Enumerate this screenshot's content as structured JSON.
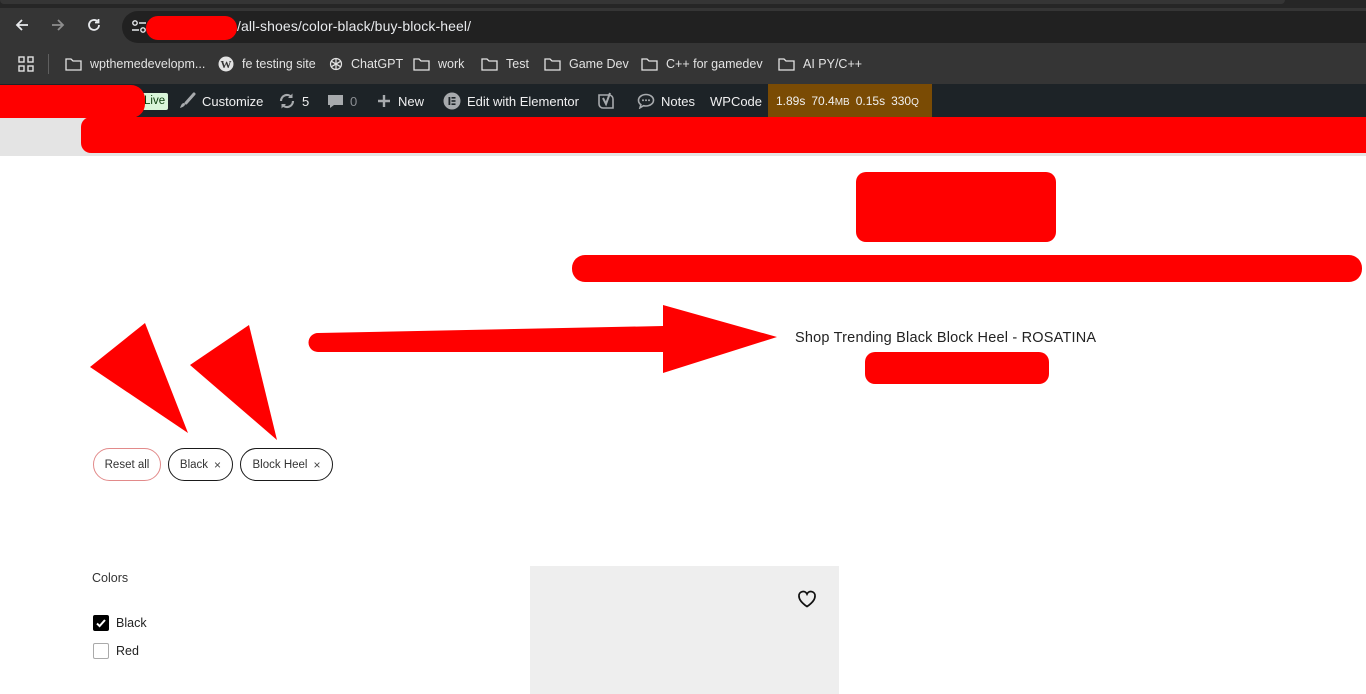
{
  "browser": {
    "url_visible": "/all-shoes/color-black/buy-block-heel/",
    "bookmarks": [
      {
        "label": "wpthemedevelopm...",
        "icon": "folder-icon"
      },
      {
        "label": "fe testing site",
        "icon": "wordpress-icon"
      },
      {
        "label": "ChatGPT",
        "icon": "chatgpt-icon"
      },
      {
        "label": "work",
        "icon": "folder-icon"
      },
      {
        "label": "Test",
        "icon": "folder-icon"
      },
      {
        "label": "Game Dev",
        "icon": "folder-icon"
      },
      {
        "label": "C++ for gamedev",
        "icon": "folder-icon"
      },
      {
        "label": "AI PY/C++",
        "icon": "folder-icon"
      }
    ]
  },
  "admin_bar": {
    "live_label": "Live",
    "customize_label": "Customize",
    "updates_count": "5",
    "comments_count": "0",
    "new_label": "New",
    "elementor_label": "Edit with Elementor",
    "notes_label": "Notes",
    "wpcode_label": "WPCode",
    "query_monitor": {
      "time": "1.89s",
      "memory": "70.4",
      "memory_unit": "MB",
      "db_time": "0.15s",
      "queries": "330",
      "queries_unit": "Q"
    }
  },
  "page": {
    "title": "Shop Trending Black Block Heel - ROSATINA"
  },
  "active_filters": {
    "reset_label": "Reset all",
    "chips": [
      {
        "label": "Black",
        "remove": "×"
      },
      {
        "label": "Block Heel",
        "remove": "×"
      }
    ]
  },
  "sidebar": {
    "colors_title": "Colors",
    "options": [
      {
        "label": "Black",
        "checked": true
      },
      {
        "label": "Red",
        "checked": false
      }
    ]
  },
  "colors": {
    "redaction": "#ff0000",
    "admin_bar": "#1d2327",
    "query_monitor": "#7a4b04"
  }
}
